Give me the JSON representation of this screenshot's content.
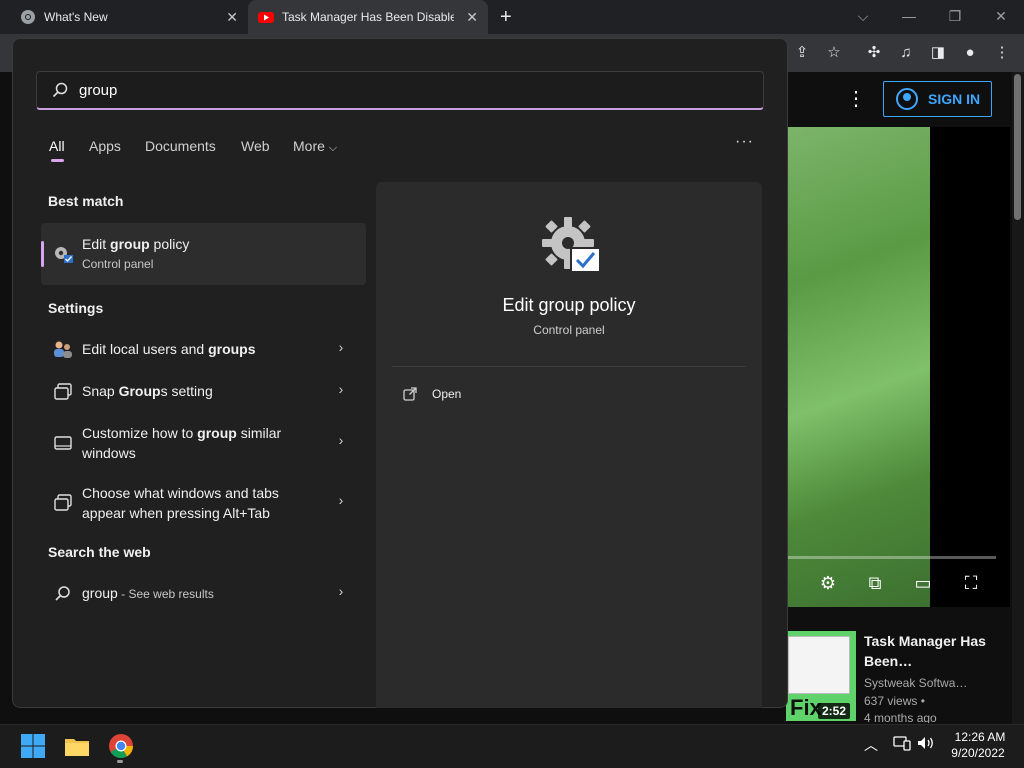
{
  "browser": {
    "tabs": [
      {
        "label": "What's New",
        "active": false
      },
      {
        "label": "Task Manager Has Been Disabled",
        "active": true
      }
    ],
    "new_tab_label": "+",
    "close_glyph": "✕"
  },
  "youtube": {
    "sign_in_label": "SIGN IN",
    "recommended": {
      "title": "Task Manager Has Been…",
      "channel": "Systweak Softwa…",
      "views": "637 views •",
      "age": "4 months ago",
      "duration": "2:52",
      "thumb_text": "Fix"
    }
  },
  "search": {
    "query": "group",
    "filters": [
      {
        "label": "All",
        "selected": true
      },
      {
        "label": "Apps"
      },
      {
        "label": "Documents"
      },
      {
        "label": "Web"
      },
      {
        "label": "More"
      }
    ],
    "more_chevron": "⌵",
    "more_dots": "···",
    "best_match": {
      "heading": "Best match",
      "title_pre": "Edit ",
      "title_bold": "group",
      "title_post": " policy",
      "subtitle": "Control panel",
      "icon": "gear-policy-icon"
    },
    "settings": {
      "heading": "Settings",
      "items": [
        {
          "pre": "Edit local users and ",
          "bold": "groups",
          "post": "",
          "icon": "users-icon"
        },
        {
          "pre": "Snap ",
          "bold": "Group",
          "post": "s setting",
          "icon": "snap-window-icon"
        },
        {
          "pre": "Customize how to ",
          "bold": "group",
          "post": " similar",
          "line2": "windows",
          "icon": "taskbar-icon"
        },
        {
          "pre": "Choose what windows and tabs",
          "bold": "",
          "post": "",
          "line2": "appear when pressing Alt+Tab",
          "icon": "snap-window-icon"
        }
      ]
    },
    "web": {
      "heading": "Search the web",
      "query": "group",
      "suffix": " - See web results"
    },
    "preview": {
      "title": "Edit group policy",
      "subtitle": "Control panel",
      "action": "Open"
    }
  },
  "taskbar": {
    "time": "12:26 AM",
    "date": "9/20/2022"
  },
  "colors": {
    "accent": "#d9a4f0",
    "yt_blue": "#3ea6ff"
  }
}
